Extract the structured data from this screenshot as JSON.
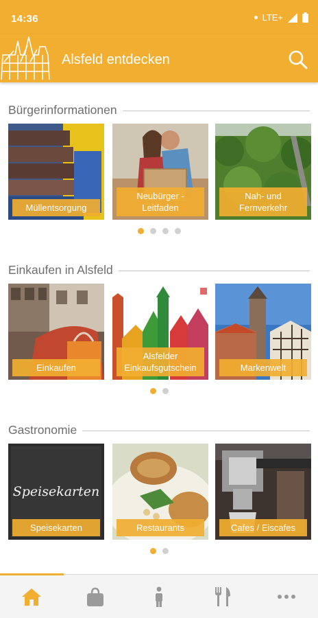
{
  "status": {
    "time": "14:36",
    "network": "LTE+"
  },
  "appbar": {
    "title": "Alsfeld entdecken",
    "logo_icon": "alsfeld-town-logo",
    "search_icon": "search-icon"
  },
  "colors": {
    "accent": "#f1ae31",
    "section_text": "#6e6e6e",
    "inactive_icon": "#9a9a9a"
  },
  "sections": [
    {
      "title": "Bürgerinformationen",
      "cards": [
        {
          "label": "Müllentsorgung",
          "image": "garbage-bins-photo"
        },
        {
          "label": "Neubürger - Leitfaden",
          "image": "couple-moving-boxes-photo"
        },
        {
          "label": "Nah- und Fernverkehr",
          "image": "green-landscape-photo"
        }
      ],
      "pager": {
        "count": 4,
        "active": 1
      }
    },
    {
      "title": "Einkaufen in Alsfeld",
      "cards": [
        {
          "label": "Einkaufen",
          "image": "shopping-bags-photo"
        },
        {
          "label_line1": "Alsfelder",
          "label_line2": "Einkaufsgutschein",
          "image": "colorful-town-illustration"
        },
        {
          "label": "Markenwelt",
          "image": "church-tower-photo"
        }
      ],
      "pager": {
        "count": 2,
        "active": 1
      }
    },
    {
      "title": "Gastronomie",
      "cards": [
        {
          "label": "Speisekarten",
          "image": "chalkboard-menu-photo",
          "board_text": "Speisekarten"
        },
        {
          "label": "Restaurants",
          "image": "food-plate-photo"
        },
        {
          "label": "Cafes / Eiscafes",
          "image": "espresso-machine-photo"
        }
      ],
      "pager": {
        "count": 2,
        "active": 1
      }
    }
  ],
  "bottom_nav": [
    {
      "icon": "home-icon",
      "active": true
    },
    {
      "icon": "shopping-bag-icon",
      "active": false
    },
    {
      "icon": "info-person-icon",
      "active": false
    },
    {
      "icon": "fork-knife-icon",
      "active": false
    },
    {
      "icon": "more-dots-icon",
      "active": false
    }
  ]
}
